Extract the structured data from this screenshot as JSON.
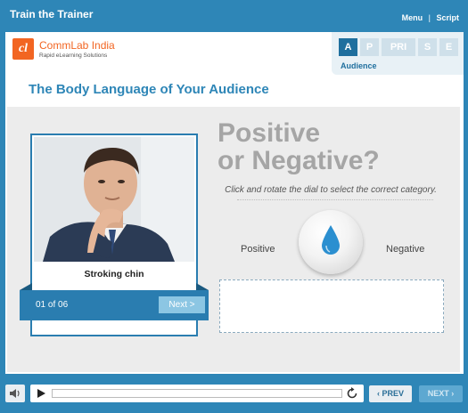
{
  "app": {
    "title": "Train the Trainer",
    "menu_label": "Menu",
    "separator": "|",
    "script_label": "Script"
  },
  "logo": {
    "mark": "cl",
    "name": "CommLab India",
    "tagline": "Rapid eLearning Solutions"
  },
  "levels": {
    "tabs": [
      {
        "label": "A",
        "active": true
      },
      {
        "label": "P",
        "active": false
      },
      {
        "label": "PRI",
        "active": false
      },
      {
        "label": "S",
        "active": false
      },
      {
        "label": "E",
        "active": false
      }
    ],
    "current_label": "Audience"
  },
  "page": {
    "title": "The Body Language of Your Audience"
  },
  "card": {
    "image_icon": "man-stroking-chin-photo",
    "caption": "Stroking chin",
    "counter": "01 of 06",
    "next_label": "Next >"
  },
  "question": {
    "title_line1": "Positive",
    "title_line2": "or Negative?",
    "instruction": "Click and rotate the dial to select the correct category.",
    "positive_label": "Positive",
    "negative_label": "Negative",
    "dial_icon": "water-drop-icon"
  },
  "player": {
    "volume_icon": "speaker-icon",
    "play_icon": "play-icon",
    "replay_icon": "replay-icon",
    "prev_label": "PREV",
    "next_label": "NEXT",
    "prev_arrow": "‹",
    "next_arrow": "›"
  },
  "colors": {
    "brand_blue": "#2e86b7",
    "logo_orange": "#f26522",
    "active_tab": "#1f6f9e",
    "question_grey": "#a5a5a5"
  }
}
